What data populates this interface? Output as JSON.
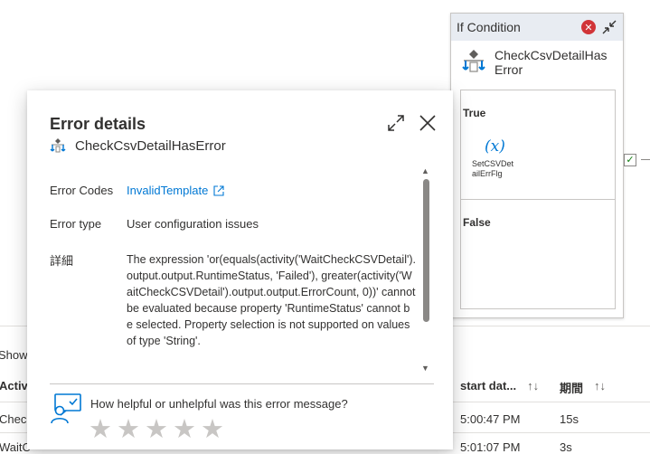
{
  "if_condition": {
    "header": "If Condition",
    "name": "CheckCsvDetailHasError",
    "name_line1": "CheckCsvDetailHas",
    "name_line2": "Error",
    "true_label": "True",
    "false_label": "False",
    "activity_line1": "SetCSVDet",
    "activity_line2": "ailErrFlg"
  },
  "table": {
    "showing": "Showi",
    "columns": [
      {
        "label": "Activi"
      },
      {
        "label": "start dat..."
      },
      {
        "label": "期間"
      }
    ],
    "rows": [
      {
        "activity": "Check",
        "start": "5:00:47 PM",
        "duration": "15s"
      },
      {
        "activity": "WaitC",
        "start": "5:01:07 PM",
        "duration": "3s"
      }
    ]
  },
  "error_panel": {
    "title": "Error details",
    "subtitle": "CheckCsvDetailHasError",
    "error_codes_label": "Error Codes",
    "error_codes_value": "InvalidTemplate",
    "error_type_label": "Error type",
    "error_type_value": "User configuration issues",
    "details_label": "詳細",
    "details_text": "The expression 'or(equals(activity('WaitCheckCSVDetail').output.output.RuntimeStatus, 'Failed'), greater(activity('WaitCheckCSVDetail').output.output.ErrorCount, 0))' cannot be evaluated because property 'RuntimeStatus' cannot be selected. Property selection is not supported on values of type 'String'.",
    "feedback_question": "How helpful or unhelpful was this error message?",
    "rating_max": 5,
    "rating_value": 0
  },
  "icons": {
    "expand": "expand-icon",
    "close": "close-icon",
    "external": "external-link-icon",
    "feedback": "feedback-person-icon",
    "star": "star-icon"
  },
  "colors": {
    "link": "#0078d4",
    "error": "#d13438",
    "star_empty": "#c8c6c4"
  }
}
